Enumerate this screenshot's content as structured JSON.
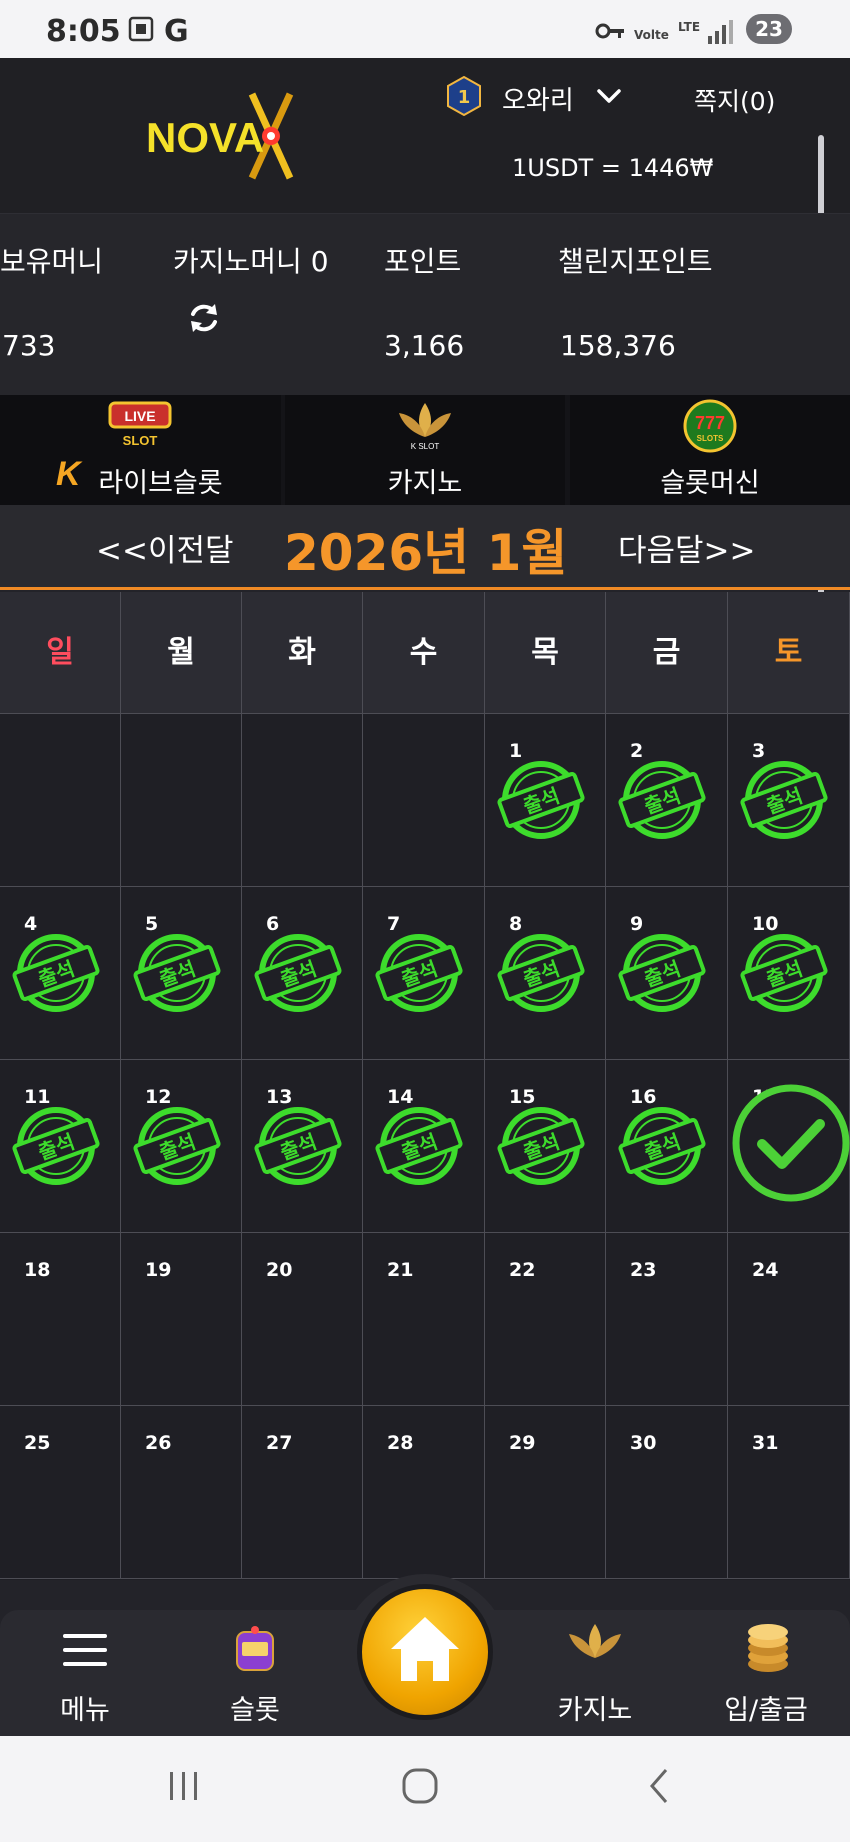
{
  "status_bar": {
    "time": "8:05",
    "g_label": "G",
    "volte": "Volte",
    "lte": "LTE",
    "battery": "23"
  },
  "header": {
    "logo_text": "NOVA",
    "tier_badge": "1",
    "username": "오와리",
    "memo": "쪽지(0)",
    "exchange_rate": "1USDT = 1446₩"
  },
  "balances": {
    "holding_label": "보유머니",
    "holding_value": "733",
    "casino_label": "카지노머니 0",
    "point_label": "포인트",
    "point_value": "3,166",
    "challenge_label": "챌린지포인트",
    "challenge_value": "158,376"
  },
  "game_tabs": [
    {
      "label": "라이브슬롯",
      "badge": "LIVE",
      "sub": "SLOT",
      "k_mark": "K"
    },
    {
      "label": "카지노",
      "badge": "K SLOT"
    },
    {
      "label": "슬롯머신",
      "badge": "777",
      "sub": "SLOTS"
    }
  ],
  "month_nav": {
    "prev": "<<이전달",
    "title": "2026년 1월",
    "next": "다음달>>"
  },
  "calendar": {
    "weekdays": [
      "일",
      "월",
      "화",
      "수",
      "목",
      "금",
      "토"
    ],
    "stamp_text": "출석",
    "weeks": [
      [
        null,
        null,
        null,
        null,
        1,
        2,
        3
      ],
      [
        4,
        5,
        6,
        7,
        8,
        9,
        10
      ],
      [
        11,
        12,
        13,
        14,
        15,
        16,
        17
      ],
      [
        18,
        19,
        20,
        21,
        22,
        23,
        24
      ],
      [
        25,
        26,
        27,
        28,
        29,
        30,
        31
      ]
    ],
    "attended_through": 16,
    "today": 17
  },
  "bottom_nav": {
    "menu": "메뉴",
    "slot": "슬롯",
    "casino": "카지노",
    "deposit": "입/출금"
  },
  "colors": {
    "accent": "#f5962a",
    "sunday": "#ff4d5e",
    "saturday": "#f5962a",
    "stamp": "#3ddc2c",
    "check": "#4cd137"
  }
}
